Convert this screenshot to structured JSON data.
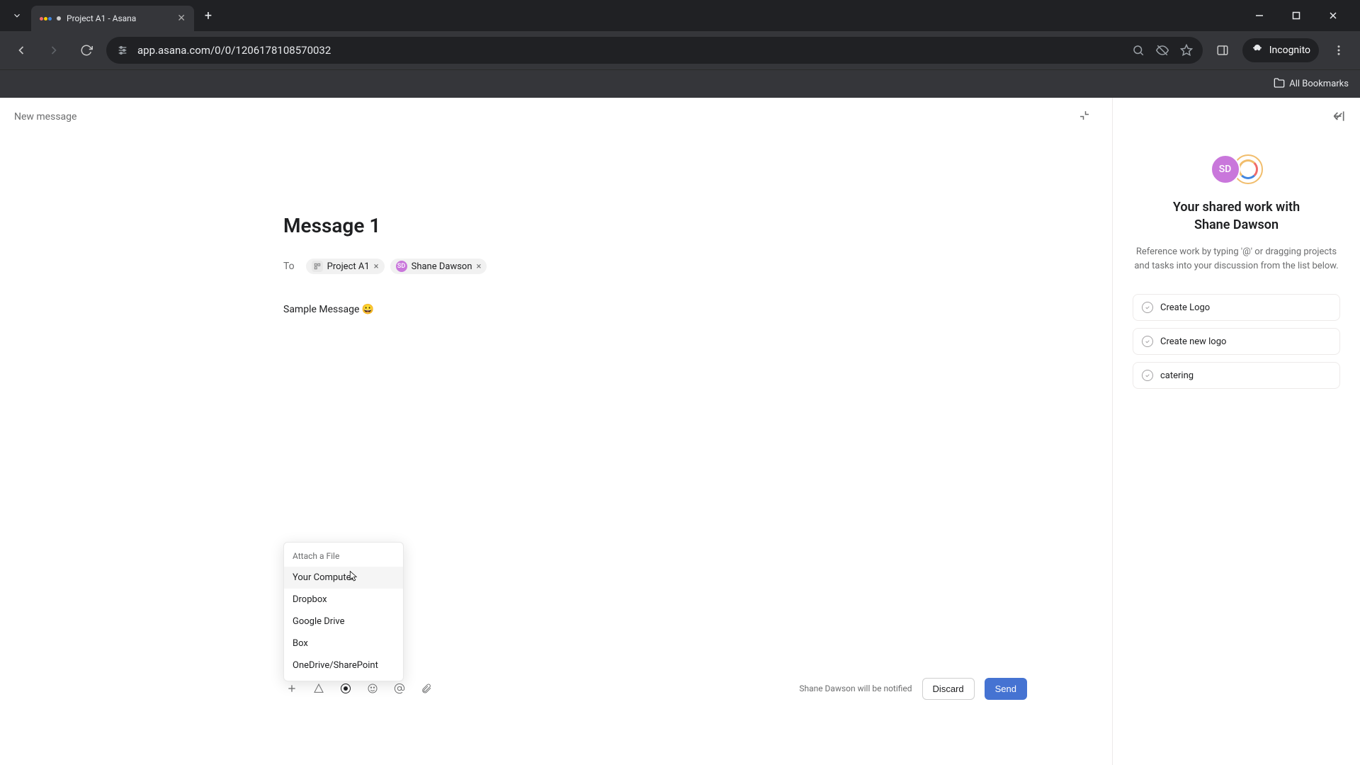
{
  "browser": {
    "tab_title": "Project A1 - Asana",
    "url": "app.asana.com/0/0/1206178108570032",
    "incognito_label": "Incognito",
    "all_bookmarks": "All Bookmarks"
  },
  "header": {
    "new_message": "New message"
  },
  "compose": {
    "title": "Message 1",
    "to_label": "To",
    "recipients": [
      {
        "kind": "project",
        "label": "Project A1"
      },
      {
        "kind": "user",
        "initials": "SD",
        "label": "Shane Dawson"
      }
    ],
    "body_text": "Sample Message 😀",
    "notify_text": "Shane Dawson will be notified",
    "discard": "Discard",
    "send": "Send"
  },
  "attach_menu": {
    "title": "Attach a File",
    "items": [
      "Your Computer",
      "Dropbox",
      "Google Drive",
      "Box",
      "OneDrive/SharePoint"
    ]
  },
  "sidebar": {
    "avatar_initials": "SD",
    "title_line1": "Your shared work with",
    "title_line2": "Shane Dawson",
    "description": "Reference work by typing '@' or dragging projects and tasks into your discussion from the list below.",
    "tasks": [
      "Create Logo",
      "Create new logo",
      "catering"
    ]
  }
}
